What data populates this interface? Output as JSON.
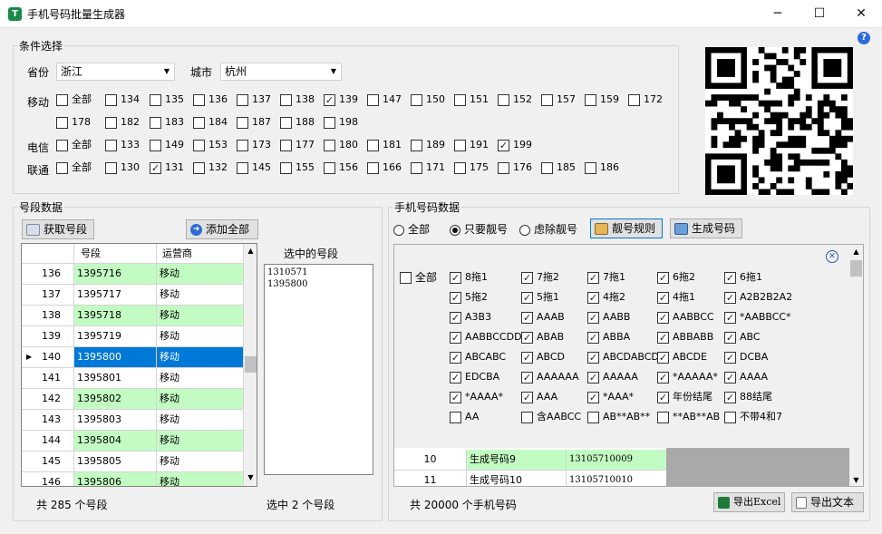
{
  "window": {
    "title": "手机号码批量生成器",
    "min": "─",
    "max": "☐",
    "close": "✕",
    "help": "?"
  },
  "conditions": {
    "legend": "条件选择",
    "province_label": "省份",
    "province_value": "浙江",
    "city_label": "城市",
    "city_value": "杭州",
    "mobile": {
      "label": "移动",
      "items": [
        {
          "t": "全部",
          "c": false
        },
        {
          "t": "134",
          "c": false
        },
        {
          "t": "135",
          "c": false
        },
        {
          "t": "136",
          "c": false
        },
        {
          "t": "137",
          "c": false
        },
        {
          "t": "138",
          "c": false
        },
        {
          "t": "139",
          "c": true
        },
        {
          "t": "147",
          "c": false
        },
        {
          "t": "150",
          "c": false
        },
        {
          "t": "151",
          "c": false
        },
        {
          "t": "152",
          "c": false
        },
        {
          "t": "157",
          "c": false
        },
        {
          "t": "159",
          "c": false
        },
        {
          "t": "172",
          "c": false
        },
        {
          "t": "178",
          "c": false
        },
        {
          "t": "182",
          "c": false
        },
        {
          "t": "183",
          "c": false
        },
        {
          "t": "184",
          "c": false
        },
        {
          "t": "187",
          "c": false
        },
        {
          "t": "188",
          "c": false
        },
        {
          "t": "198",
          "c": false
        }
      ]
    },
    "telecom": {
      "label": "电信",
      "items": [
        {
          "t": "全部",
          "c": false
        },
        {
          "t": "133",
          "c": false
        },
        {
          "t": "149",
          "c": false
        },
        {
          "t": "153",
          "c": false
        },
        {
          "t": "173",
          "c": false
        },
        {
          "t": "177",
          "c": false
        },
        {
          "t": "180",
          "c": false
        },
        {
          "t": "181",
          "c": false
        },
        {
          "t": "189",
          "c": false
        },
        {
          "t": "191",
          "c": false
        },
        {
          "t": "199",
          "c": true
        }
      ]
    },
    "unicom": {
      "label": "联通",
      "items": [
        {
          "t": "全部",
          "c": false
        },
        {
          "t": "130",
          "c": false
        },
        {
          "t": "131",
          "c": true
        },
        {
          "t": "132",
          "c": false
        },
        {
          "t": "145",
          "c": false
        },
        {
          "t": "155",
          "c": false
        },
        {
          "t": "156",
          "c": false
        },
        {
          "t": "166",
          "c": false
        },
        {
          "t": "171",
          "c": false
        },
        {
          "t": "175",
          "c": false
        },
        {
          "t": "176",
          "c": false
        },
        {
          "t": "185",
          "c": false
        },
        {
          "t": "186",
          "c": false
        }
      ]
    }
  },
  "segment": {
    "legend": "号段数据",
    "get_button": "获取号段",
    "add_all_button": "添加全部",
    "col_segment": "号段",
    "col_carrier": "运营商",
    "rows": [
      {
        "n": "136",
        "seg": "1395716",
        "op": "移动"
      },
      {
        "n": "137",
        "seg": "1395717",
        "op": "移动"
      },
      {
        "n": "138",
        "seg": "1395718",
        "op": "移动"
      },
      {
        "n": "139",
        "seg": "1395719",
        "op": "移动"
      },
      {
        "n": "140",
        "seg": "1395800",
        "op": "移动"
      },
      {
        "n": "141",
        "seg": "1395801",
        "op": "移动"
      },
      {
        "n": "142",
        "seg": "1395802",
        "op": "移动"
      },
      {
        "n": "143",
        "seg": "1395803",
        "op": "移动"
      },
      {
        "n": "144",
        "seg": "1395804",
        "op": "移动"
      },
      {
        "n": "145",
        "seg": "1395805",
        "op": "移动"
      },
      {
        "n": "146",
        "seg": "1395806",
        "op": "移动"
      }
    ],
    "selected_row": "140",
    "selected_title": "选中的号段",
    "selected_items": [
      "1310571",
      "1395800"
    ],
    "total_text": "共 285 个号段",
    "selected_count_text": "选中 2 个号段"
  },
  "phone": {
    "legend": "手机号码数据",
    "radio_all": "全部",
    "radio_only": "只要靓号",
    "radio_filter": "虑除靓号",
    "radio_selected": "只要靓号",
    "rules_button": "靓号规则",
    "generate_button": "生成号码",
    "check_all": "全部",
    "rules": [
      {
        "t": "8拖1",
        "c": true
      },
      {
        "t": "7拖2",
        "c": true
      },
      {
        "t": "7拖1",
        "c": true
      },
      {
        "t": "6拖2",
        "c": true
      },
      {
        "t": "6拖1",
        "c": true
      },
      {
        "t": "5拖2",
        "c": true
      },
      {
        "t": "5拖1",
        "c": true
      },
      {
        "t": "4拖2",
        "c": true
      },
      {
        "t": "4拖1",
        "c": true
      },
      {
        "t": "A2B2B2A2",
        "c": true
      },
      {
        "t": "A3B3",
        "c": true
      },
      {
        "t": "AAAB",
        "c": true
      },
      {
        "t": "AABB",
        "c": true
      },
      {
        "t": "AABBCC",
        "c": true
      },
      {
        "t": "*AABBCC*",
        "c": true
      },
      {
        "t": "AABBCCDD",
        "c": true
      },
      {
        "t": "ABAB",
        "c": true
      },
      {
        "t": "ABBA",
        "c": true
      },
      {
        "t": "ABBABB",
        "c": true
      },
      {
        "t": "ABC",
        "c": true
      },
      {
        "t": "ABCABC",
        "c": true
      },
      {
        "t": "ABCD",
        "c": true
      },
      {
        "t": "ABCDABCD",
        "c": true
      },
      {
        "t": "ABCDE",
        "c": true
      },
      {
        "t": "DCBA",
        "c": true
      },
      {
        "t": "EDCBA",
        "c": true
      },
      {
        "t": "AAAAAA",
        "c": true
      },
      {
        "t": "AAAAA",
        "c": true
      },
      {
        "t": "*AAAAA*",
        "c": true
      },
      {
        "t": "AAAA",
        "c": true
      },
      {
        "t": "*AAAA*",
        "c": true
      },
      {
        "t": "AAA",
        "c": true
      },
      {
        "t": "*AAA*",
        "c": true
      },
      {
        "t": "年份结尾",
        "c": true
      },
      {
        "t": "88结尾",
        "c": true
      },
      {
        "t": "AA",
        "c": false
      },
      {
        "t": "含AABCC",
        "c": false
      },
      {
        "t": "AB**AB**",
        "c": false
      },
      {
        "t": "**AB**AB",
        "c": false
      },
      {
        "t": "不带4和7",
        "c": false
      }
    ],
    "result_rows": [
      {
        "n": "10",
        "name": "生成号码9",
        "num": "13105710009"
      },
      {
        "n": "11",
        "name": "生成号码10",
        "num": "13105710010"
      }
    ],
    "total_text": "共 20000 个手机号码",
    "export_excel": "导出Excel",
    "export_text": "导出文本"
  },
  "colors": {
    "green_row": "#c3fcc3",
    "selected_row": "#0078d7",
    "brand": "#1a8a4a"
  }
}
